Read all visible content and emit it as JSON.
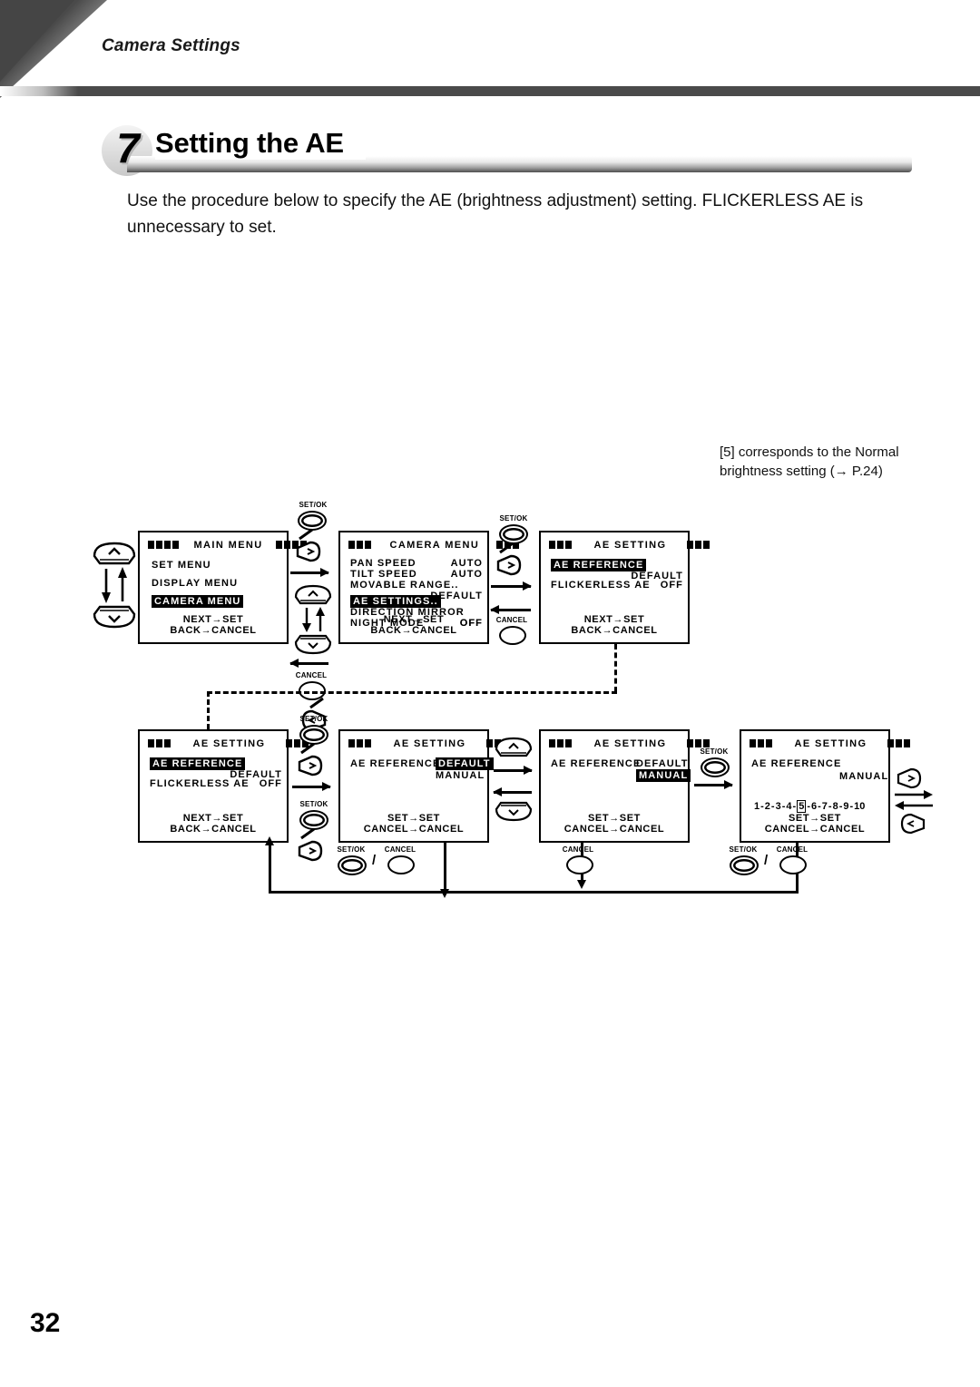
{
  "header": {
    "breadcrumb": "Camera Settings"
  },
  "section": {
    "number": "7",
    "title": "Setting the AE",
    "intro": "Use the procedure below to specify the AE (brightness adjustment) setting. FLICKERLESS AE is unnecessary to set."
  },
  "note": "[5] corresponds to the Normal brightness setting (→ P.24)",
  "page_number": "32",
  "buttons": {
    "set_ok": "SET/OK",
    "cancel": "CANCEL",
    "slash": "/"
  },
  "screens": [
    {
      "id": "main-menu",
      "title": "MAIN MENU",
      "lines": [
        {
          "label": "SET MENU",
          "value": "",
          "highlight": false
        },
        {
          "label": "DISPLAY MENU",
          "value": "",
          "highlight": false
        },
        {
          "label": "CAMERA MENU",
          "value": "",
          "highlight": true
        }
      ],
      "footer": "NEXT→SET  BACK→CANCEL"
    },
    {
      "id": "camera-menu",
      "title": "CAMERA MENU",
      "lines": [
        {
          "label": "PAN  SPEED",
          "value": "AUTO",
          "highlight": false
        },
        {
          "label": "TILT SPEED",
          "value": "AUTO",
          "highlight": false
        },
        {
          "label": "MOVABLE RANGE..",
          "value": "DEFAULT",
          "highlight": false
        },
        {
          "label": "AE SETTINGS..",
          "value": "",
          "highlight": true
        },
        {
          "label": "DIRECTION MIRROR",
          "value": "OFF",
          "highlight": false
        },
        {
          "label": "NIGHT MODE",
          "value": "OFF",
          "highlight": false
        }
      ],
      "footer": "NEXT→SET  BACK→CANCEL"
    },
    {
      "id": "ae-setting-1",
      "title": "AE SETTING",
      "lines": [
        {
          "label": "AE REFERENCE",
          "value": "DEFAULT",
          "highlight": true
        },
        {
          "label": "FLICKERLESS AE",
          "value": "OFF",
          "highlight": false
        }
      ],
      "footer": "NEXT→SET  BACK→CANCEL"
    },
    {
      "id": "ae-setting-2",
      "title": "AE SETTING",
      "lines": [
        {
          "label": "AE REFERENCE",
          "value": "DEFAULT",
          "highlight": true
        },
        {
          "label": "FLICKERLESS AE",
          "value": "OFF",
          "highlight": false
        }
      ],
      "footer": "NEXT→SET  BACK→CANCEL"
    },
    {
      "id": "ae-ref-default",
      "title": "AE SETTING",
      "label": "AE REFERENCE",
      "options": [
        {
          "text": "DEFAULT",
          "highlight": true
        },
        {
          "text": "MANUAL",
          "highlight": false
        }
      ],
      "footer": "SET→SET CANCEL→CANCEL"
    },
    {
      "id": "ae-ref-manual",
      "title": "AE SETTING",
      "label": "AE REFERENCE",
      "options": [
        {
          "text": "DEFAULT",
          "highlight": false
        },
        {
          "text": "MANUAL",
          "highlight": true
        }
      ],
      "footer": "SET→SET CANCEL→CANCEL"
    },
    {
      "id": "ae-level-scale",
      "title": "AE SETTING",
      "label": "AE REFERENCE",
      "value": "MANUAL",
      "scale": [
        "1",
        "2",
        "3",
        "4",
        "5",
        "6",
        "7",
        "8",
        "9",
        "10"
      ],
      "scale_selected": "5",
      "footer": "SET→SET CANCEL→CANCEL"
    }
  ]
}
